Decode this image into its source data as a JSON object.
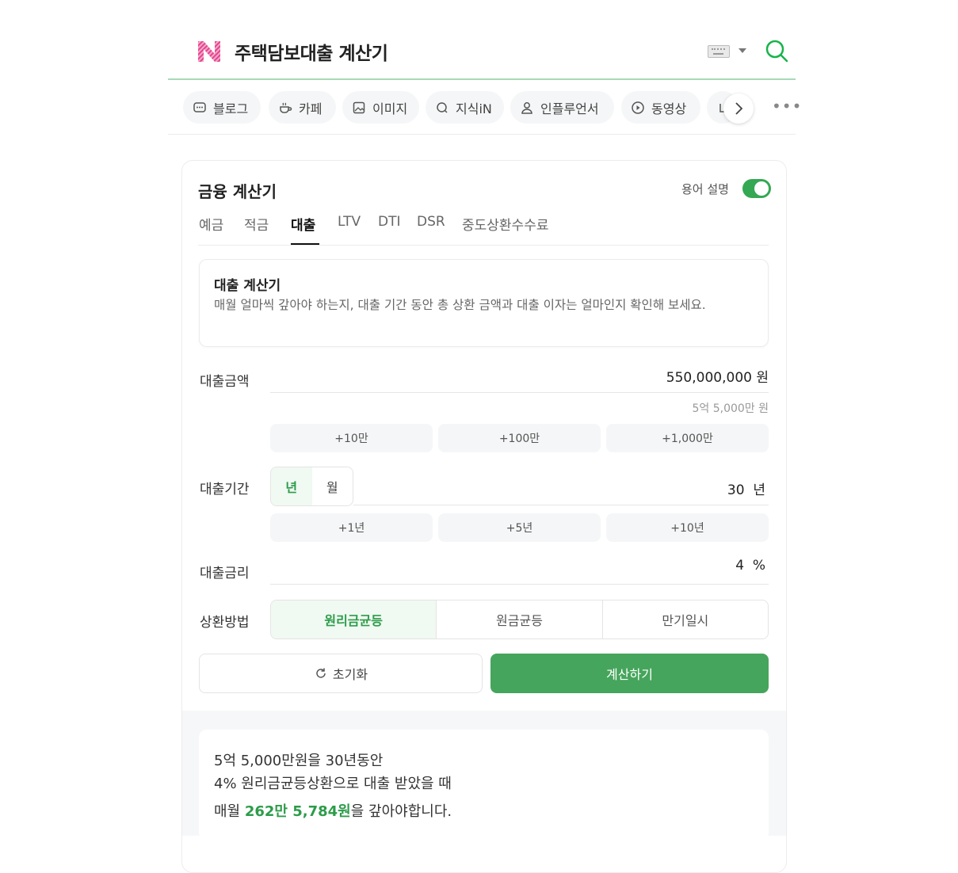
{
  "header": {
    "title": "주택담보대출 계산기"
  },
  "chips": [
    {
      "label": "블로그",
      "icon": "blog-icon"
    },
    {
      "label": "카페",
      "icon": "cafe-icon"
    },
    {
      "label": "이미지",
      "icon": "image-icon"
    },
    {
      "label": "지식iN",
      "icon": "kin-icon"
    },
    {
      "label": "인플루언서",
      "icon": "influencer-icon"
    },
    {
      "label": "동영상",
      "icon": "video-icon"
    }
  ],
  "calculator": {
    "title": "금융 계산기",
    "term_label": "용어 설명",
    "term_enabled": true,
    "tabs": [
      "예금",
      "적금",
      "대출",
      "LTV",
      "DTI",
      "DSR",
      "중도상환수수료"
    ],
    "active_tab": "대출",
    "info": {
      "title": "대출 계산기",
      "desc": "매월 얼마씩 갚아야 하는지, 대출 기간 동안 총 상환 금액과 대출 이자는 얼마인지 확인해 보세요."
    },
    "amount": {
      "label": "대출금액",
      "value": "550,000,000",
      "unit": "원",
      "korean": "5억 5,000만 원",
      "buttons": [
        "+10만",
        "+100만",
        "+1,000만"
      ]
    },
    "period": {
      "label": "대출기간",
      "unit_options": [
        "년",
        "월"
      ],
      "selected_unit": "년",
      "value": "30",
      "unit": "년",
      "buttons": [
        "+1년",
        "+5년",
        "+10년"
      ]
    },
    "rate": {
      "label": "대출금리",
      "value": "4",
      "unit": "%"
    },
    "method": {
      "label": "상환방법",
      "options": [
        "원리금균등",
        "원금균등",
        "만기일시"
      ],
      "selected": "원리금균등"
    },
    "reset_label": "초기화",
    "calc_label": "계산하기"
  },
  "result": {
    "line1": "5억 5,000만원을 30년동안",
    "line2": "4% 원리금균등상환으로 대출 받았을 때",
    "line3_prefix": "매월 ",
    "line3_amount": "262만 5,784원",
    "line3_suffix": "을 갚아야합니다."
  },
  "colors": {
    "accent": "#46a55c",
    "accent_text": "#2d9c4a",
    "header_line": "#a7dab8"
  }
}
